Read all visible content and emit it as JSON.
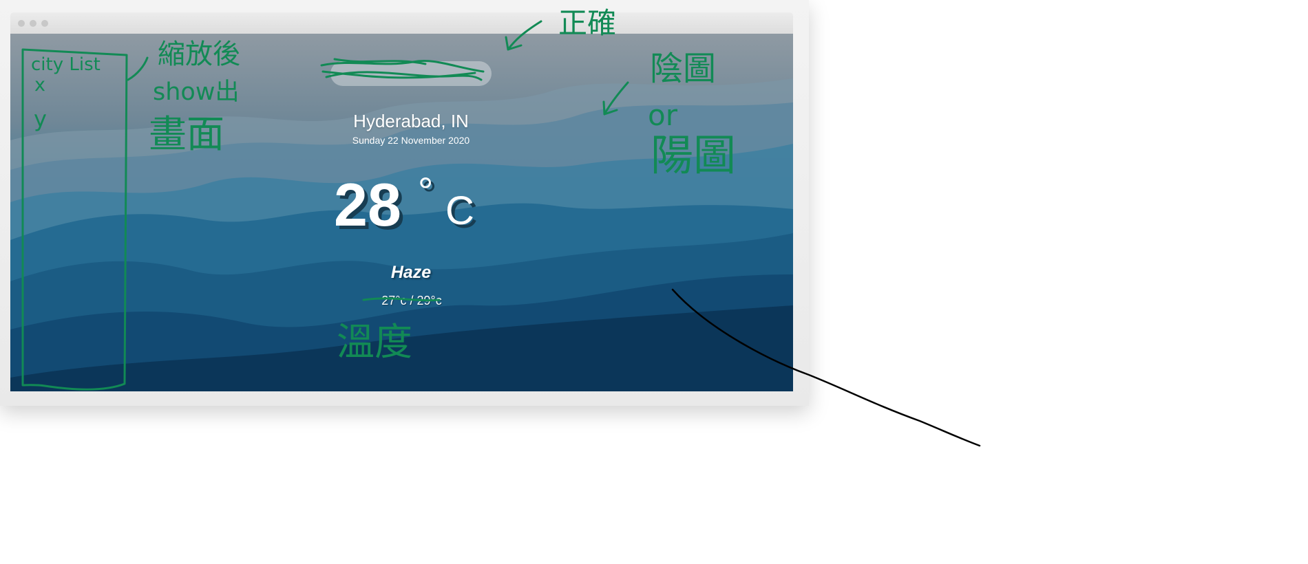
{
  "window": {
    "controls": [
      "close-control",
      "minimize-control",
      "maximize-control"
    ]
  },
  "search": {
    "value": "",
    "placeholder": ""
  },
  "weather": {
    "city": "Hyderabad, IN",
    "date": "Sunday 22 November 2020",
    "temperature": "28",
    "degree_symbol": "°",
    "unit": "C",
    "condition": "Haze",
    "range": "27°c / 29°c"
  },
  "annotations": {
    "city_list": "city List",
    "city_list_items": [
      "x",
      "y"
    ],
    "side_note_1": "縮放後",
    "side_note_2": "show出",
    "side_note_3": "畫面",
    "correct_note": "正確",
    "yin_note": "陰圖",
    "or_note": "or",
    "sun_note": "陽圖",
    "temp_note": "溫度"
  },
  "colors": {
    "annotation_green": "#128a55",
    "sky_top": "#8f9aa3",
    "mountain_blue": "#1e5d84",
    "temperature_shadow": "#173d52"
  }
}
